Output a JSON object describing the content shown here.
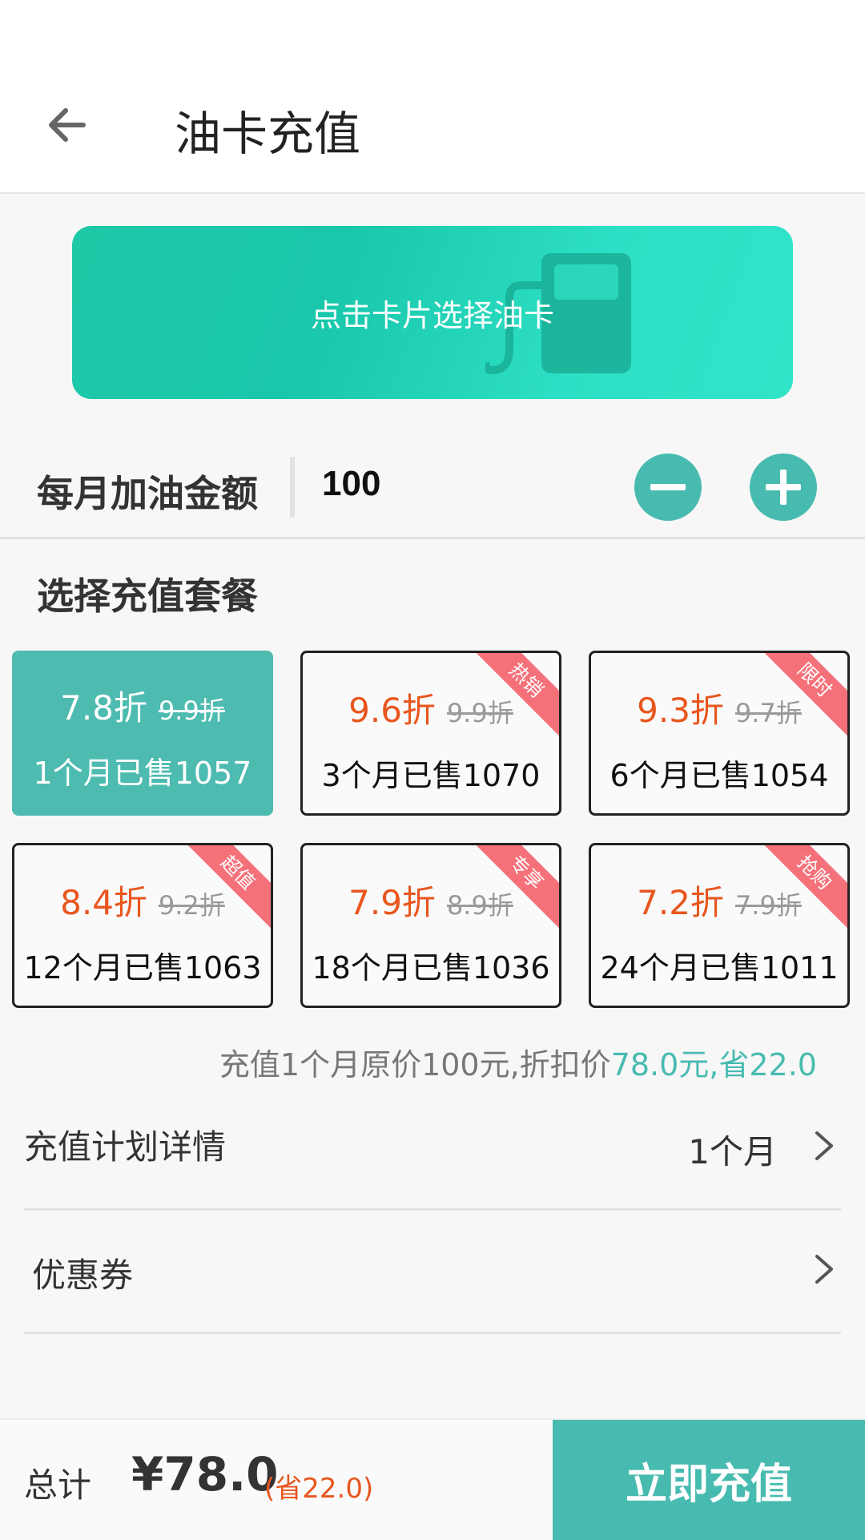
{
  "header": {
    "title": "油卡充值"
  },
  "card_banner": {
    "text": "点击卡片选择油卡",
    "icon": "fuel-pump-icon"
  },
  "monthly_amount": {
    "label": "每月加油金额",
    "value": "100"
  },
  "plans_section": {
    "title": "选择充值套餐"
  },
  "plans": [
    {
      "discount": "7.8折",
      "original": "9.9折",
      "sold": "1个月已售1057",
      "tag": "",
      "selected": true
    },
    {
      "discount": "9.6折",
      "original": "9.9折",
      "sold": "3个月已售1070",
      "tag": "热销",
      "selected": false
    },
    {
      "discount": "9.3折",
      "original": "9.7折",
      "sold": "6个月已售1054",
      "tag": "限时",
      "selected": false
    },
    {
      "discount": "8.4折",
      "original": "9.2折",
      "sold": "12个月已售1063",
      "tag": "超值",
      "selected": false
    },
    {
      "discount": "7.9折",
      "original": "8.9折",
      "sold": "18个月已售1036",
      "tag": "专享",
      "selected": false
    },
    {
      "discount": "7.2折",
      "original": "7.9折",
      "sold": "24个月已售1011",
      "tag": "抢购",
      "selected": false
    }
  ],
  "summary": {
    "prefix": "充值1个月原价100元,折扣价",
    "highlight": "78.0元,省22.0"
  },
  "plan_details": {
    "label": "充值计划详情",
    "value": "1个月"
  },
  "coupon": {
    "label": "优惠券"
  },
  "footer": {
    "total_label": "总计",
    "total_price": "¥78.0",
    "saving": "(省22.0)",
    "pay_label": "立即充值"
  },
  "colors": {
    "accent": "#48bbb0",
    "discount": "#e8561e",
    "ribbon": "#f5717a",
    "banner": "#1ec9a8"
  }
}
